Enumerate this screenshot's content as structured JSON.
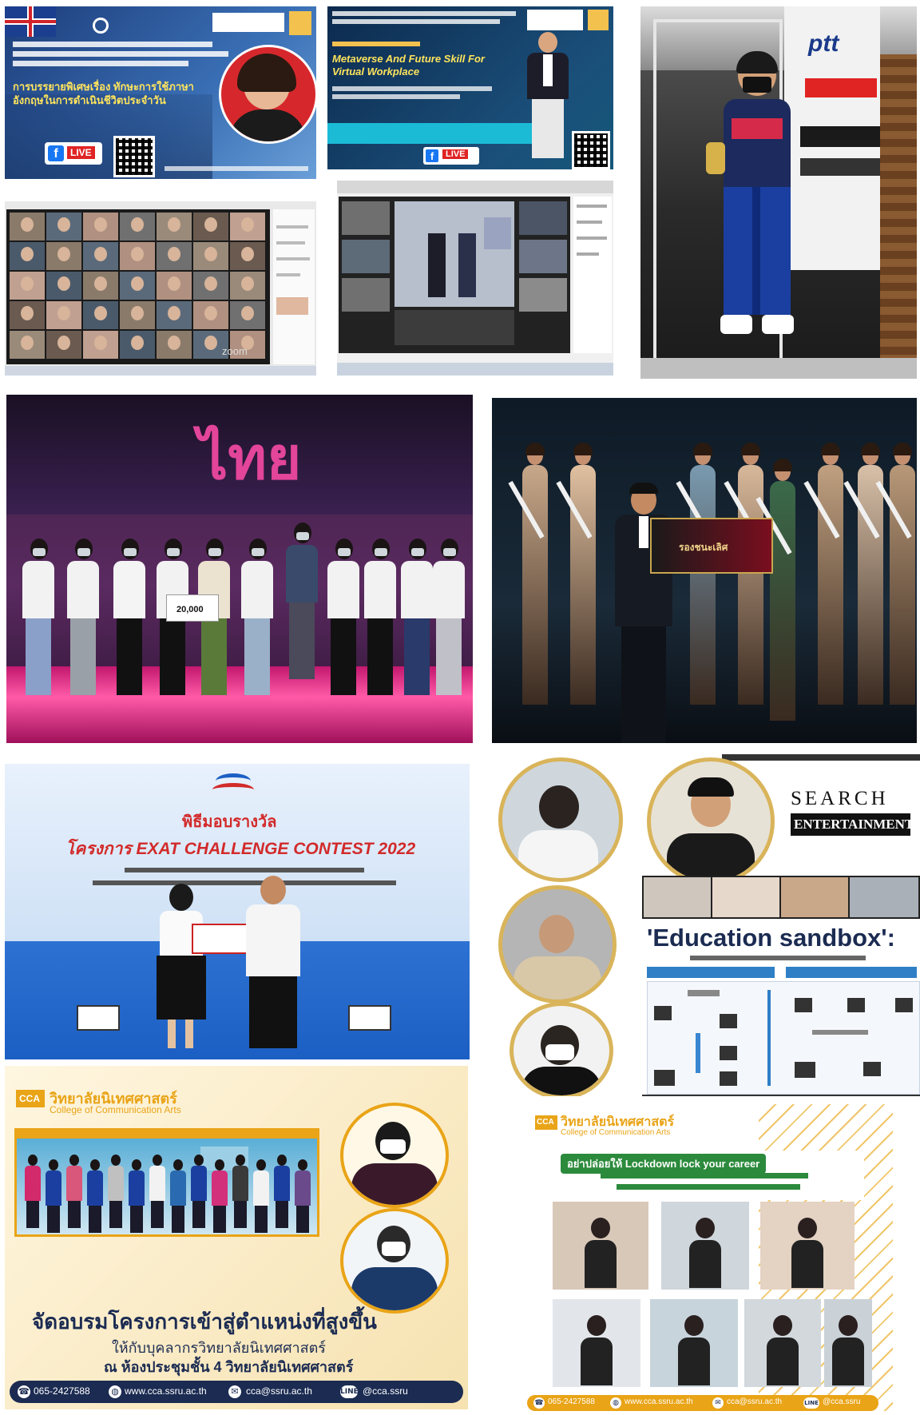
{
  "collage": {
    "uk_poster": {
      "title": "การบรรยายพิเศษเรื่อง ทักษะการใช้ภาษาอังกฤษในการดำเนินชีวิตประจำวัน",
      "live_label": "LIVE"
    },
    "metaverse_poster": {
      "title": "Metaverse And Future Skill For Virtual Workplace",
      "live_label": "LIVE"
    },
    "zoom_screen": {
      "watermark": "zoom"
    },
    "race_photo": {
      "sponsor": "ptt"
    },
    "stage_photo": {
      "sign": "ไทย",
      "check_amount": "20,000"
    },
    "pageant_photo": {
      "award_text": "รองชนะเลิศ"
    },
    "exat_photo": {
      "caption": "พิธีมอบรางวัล",
      "title": "โครงการ EXAT CHALLENGE CONTEST 2022"
    },
    "sandbox": {
      "brand_top": "SEARCH",
      "brand_bottom": "ENTERTAINMENT",
      "title": "'Education sandbox':"
    },
    "cca_training": {
      "logo": "CCA",
      "college_th": "วิทยาลัยนิเทศศาสตร์",
      "college_en": "College of Communication Arts",
      "headline": "จัดอบรมโครงการเข้าสู่ตำแหน่งที่สูงขึ้น",
      "subline1": "ให้กับบุคลากรวิทยาลัยนิเทศศาสตร์",
      "subline2": "ณ ห้องประชุมชั้น 4 วิทยาลัยนิเทศศาสตร์",
      "phone": "065-2427588",
      "web": "www.cca.ssru.ac.th",
      "email": "cca@ssru.ac.th",
      "line": "@cca.ssru"
    },
    "cca_lockdown": {
      "logo": "CCA",
      "college_th": "วิทยาลัยนิเทศศาสตร์",
      "college_en": "College of Communication Arts",
      "headline": "อย่าปล่อยให้ Lockdown lock your career",
      "phone": "065-2427588",
      "web": "www.cca.ssru.ac.th",
      "email": "cca@ssru.ac.th",
      "line": "@cca.ssru"
    },
    "colors": {
      "cca_yellow": "#e9a417",
      "navy": "#1b2b52",
      "stage_pink": "#d9257c",
      "exat_blue": "#1c6fd8",
      "green_banner": "#2c8a3c"
    }
  }
}
